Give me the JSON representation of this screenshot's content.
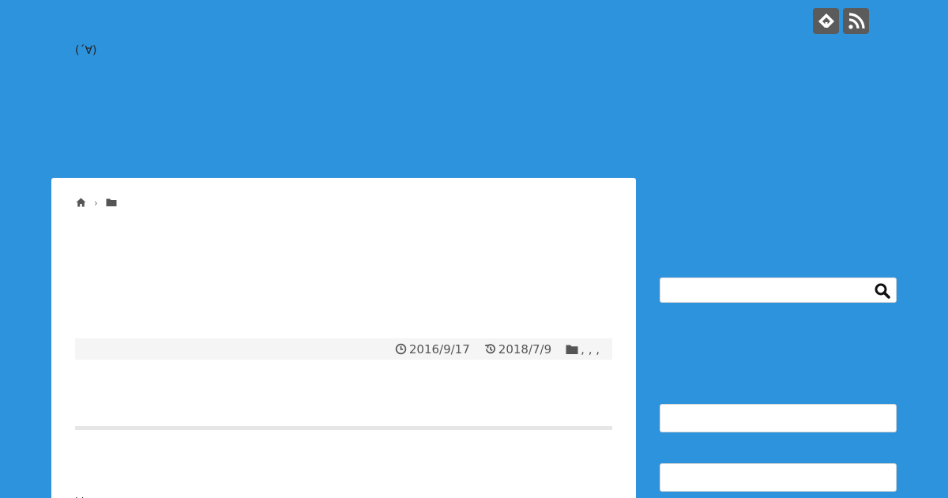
{
  "header": {
    "site_title": "(´∀)",
    "icons": [
      "feedly-icon",
      "rss-icon"
    ]
  },
  "breadcrumb": {
    "icons": [
      "home-icon",
      "folder-icon"
    ]
  },
  "post_meta": {
    "published_date": "2016/9/17",
    "updated_date": "2018/7/9",
    "categories": ", , ,"
  },
  "body": {
    "partial_text": "· ·"
  },
  "sidebar": {
    "search": {
      "placeholder": "",
      "value": ""
    }
  },
  "colors": {
    "background": "#2e93dd",
    "card": "#ffffff",
    "icon_bg": "#5b5b5b",
    "meta_bg": "#f5f5f5"
  }
}
